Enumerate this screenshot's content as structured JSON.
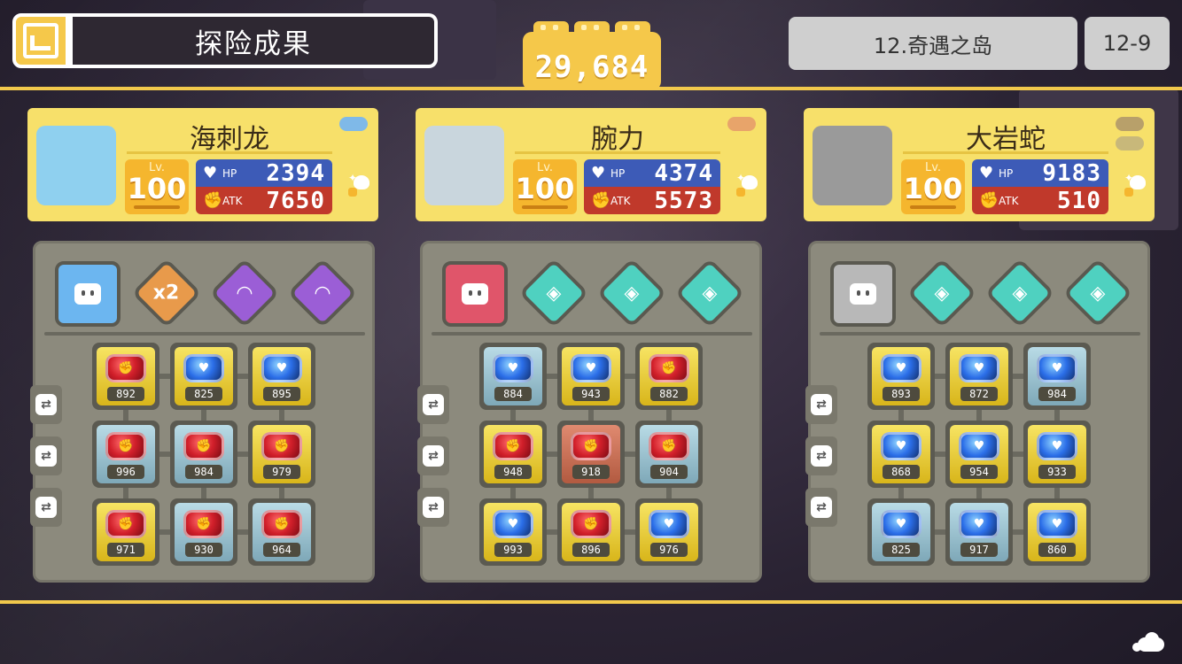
{
  "header": {
    "title": "探险成果",
    "score": "29,684",
    "area": "12.奇遇之岛",
    "stage": "12-9"
  },
  "pokemon": [
    {
      "name": "海刺龙",
      "portrait_color": "#8fd0ef",
      "badge_colors": [
        "#7fb9e8"
      ],
      "lv_label": "Lv.",
      "level": "100",
      "hp_label": "HP",
      "hp": "2394",
      "atk_label": "ATK",
      "atk": "7650",
      "main_skill": {
        "icon": "robot-icon",
        "color": "#6cb6f0"
      },
      "skills": [
        {
          "icon": "lightning-x2-icon",
          "color": "#e89a4b",
          "text": "x2"
        },
        {
          "icon": "wifi-icon",
          "color": "#9b5ed6",
          "text": "◠"
        },
        {
          "icon": "wifi-icon",
          "color": "#9b5ed6",
          "text": "◠"
        }
      ],
      "stones": [
        {
          "gem": "red",
          "frame": "gold",
          "value": "892"
        },
        {
          "gem": "blue",
          "frame": "gold",
          "value": "825"
        },
        {
          "gem": "blue",
          "frame": "gold",
          "value": "895"
        },
        {
          "gem": "red",
          "frame": "silver",
          "value": "996"
        },
        {
          "gem": "red",
          "frame": "silver",
          "value": "984"
        },
        {
          "gem": "red",
          "frame": "gold",
          "value": "979"
        },
        {
          "gem": "red",
          "frame": "gold",
          "value": "971"
        },
        {
          "gem": "red",
          "frame": "silver",
          "value": "930"
        },
        {
          "gem": "red",
          "frame": "silver",
          "value": "964"
        }
      ]
    },
    {
      "name": "腕力",
      "portrait_color": "#c9d6dd",
      "badge_colors": [
        "#e8a46a"
      ],
      "lv_label": "Lv.",
      "level": "100",
      "hp_label": "HP",
      "hp": "4374",
      "atk_label": "ATK",
      "atk": "5573",
      "main_skill": {
        "icon": "robot-icon",
        "color": "#e0556a"
      },
      "skills": [
        {
          "icon": "robot-diamond-icon",
          "color": "#4fd1c0",
          "text": "◈"
        },
        {
          "icon": "robot-diamond-icon",
          "color": "#4fd1c0",
          "text": "◈"
        },
        {
          "icon": "robot-diamond-icon",
          "color": "#4fd1c0",
          "text": "◈"
        }
      ],
      "stones": [
        {
          "gem": "blue",
          "frame": "silver",
          "value": "884"
        },
        {
          "gem": "blue",
          "frame": "gold",
          "value": "943"
        },
        {
          "gem": "red",
          "frame": "gold",
          "value": "882"
        },
        {
          "gem": "red",
          "frame": "gold",
          "value": "948"
        },
        {
          "gem": "red",
          "frame": "bronze",
          "value": "918"
        },
        {
          "gem": "red",
          "frame": "silver",
          "value": "904"
        },
        {
          "gem": "blue",
          "frame": "gold",
          "value": "993"
        },
        {
          "gem": "red",
          "frame": "gold",
          "value": "896"
        },
        {
          "gem": "blue",
          "frame": "gold",
          "value": "976"
        }
      ]
    },
    {
      "name": "大岩蛇",
      "portrait_color": "#9a9a9a",
      "badge_colors": [
        "#b8a06a",
        "#c8b87a"
      ],
      "lv_label": "Lv.",
      "level": "100",
      "hp_label": "HP",
      "hp": "9183",
      "atk_label": "ATK",
      "atk": "510",
      "main_skill": {
        "icon": "robot-icon",
        "color": "#b8b8b8"
      },
      "skills": [
        {
          "icon": "robot-diamond-icon",
          "color": "#4fd1c0",
          "text": "◈"
        },
        {
          "icon": "robot-diamond-icon",
          "color": "#4fd1c0",
          "text": "◈"
        },
        {
          "icon": "robot-diamond-icon",
          "color": "#4fd1c0",
          "text": "◈"
        }
      ],
      "stones": [
        {
          "gem": "blue",
          "frame": "gold",
          "value": "893"
        },
        {
          "gem": "blue",
          "frame": "gold",
          "value": "872"
        },
        {
          "gem": "blue",
          "frame": "silver",
          "value": "984"
        },
        {
          "gem": "blue",
          "frame": "gold",
          "value": "868"
        },
        {
          "gem": "blue",
          "frame": "gold",
          "value": "954"
        },
        {
          "gem": "blue",
          "frame": "gold",
          "value": "933"
        },
        {
          "gem": "blue",
          "frame": "silver",
          "value": "825"
        },
        {
          "gem": "blue",
          "frame": "silver",
          "value": "917"
        },
        {
          "gem": "blue",
          "frame": "gold",
          "value": "860"
        }
      ]
    }
  ]
}
